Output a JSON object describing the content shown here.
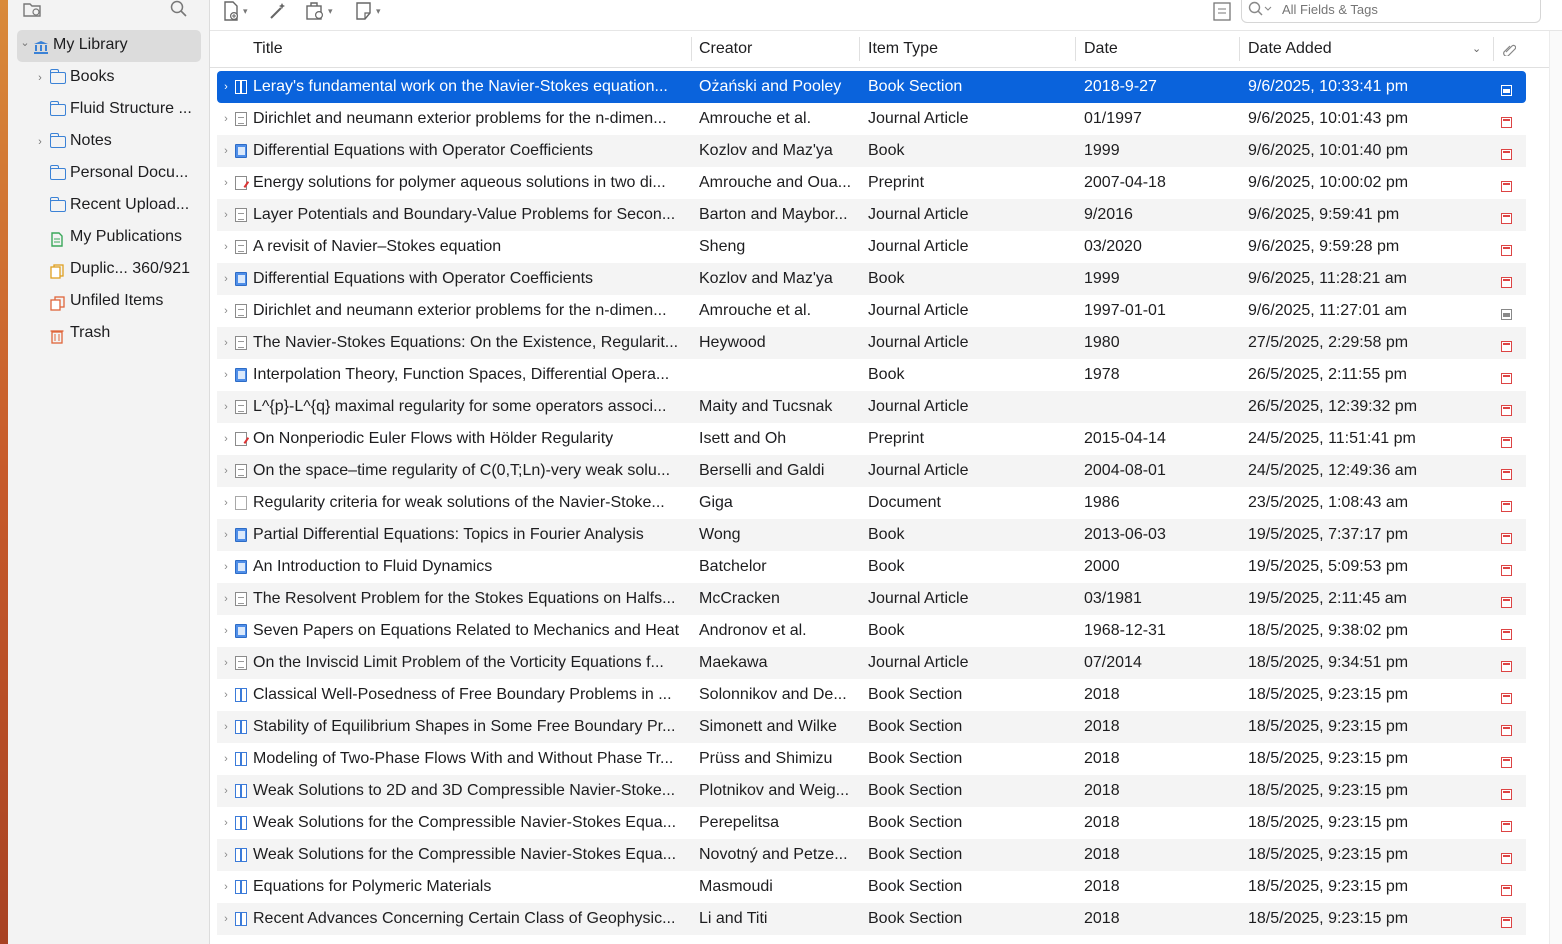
{
  "sidebar": {
    "items": [
      {
        "label": "My Library",
        "icon": "library-icon",
        "selected": true,
        "expandable": true,
        "expanded": true
      },
      {
        "label": "Books",
        "icon": "folder-icon",
        "expandable": true
      },
      {
        "label": "Fluid Structure ...",
        "icon": "folder-icon"
      },
      {
        "label": "Notes",
        "icon": "folder-icon",
        "expandable": true
      },
      {
        "label": "Personal Docu...",
        "icon": "folder-icon"
      },
      {
        "label": "Recent Upload...",
        "icon": "folder-icon"
      },
      {
        "label": "My Publications",
        "icon": "publications-icon"
      },
      {
        "label": "Duplic... 360/921",
        "icon": "duplicates-icon"
      },
      {
        "label": "Unfiled Items",
        "icon": "unfiled-icon"
      },
      {
        "label": "Trash",
        "icon": "trash-icon"
      }
    ]
  },
  "search": {
    "placeholder": "All Fields & Tags"
  },
  "columns": {
    "title": "Title",
    "creator": "Creator",
    "item_type": "Item Type",
    "date": "Date",
    "date_added": "Date Added"
  },
  "items": [
    {
      "title": "Leray's fundamental work on the Navier-Stokes equation...",
      "creator": "Ożański and Pooley",
      "type": "Book Section",
      "date": "2018-9-27",
      "added": "9/6/2025, 10:33:41 pm",
      "icon": "section",
      "att": "snap",
      "selected": true
    },
    {
      "title": "Dirichlet and neumann exterior problems for the n-dimen...",
      "creator": "Amrouche et al.",
      "type": "Journal Article",
      "date": "01/1997",
      "added": "9/6/2025, 10:01:43 pm",
      "icon": "article",
      "att": "pdf"
    },
    {
      "title": "Differential Equations with Operator Coefficients",
      "creator": "Kozlov and Maz'ya",
      "type": "Book",
      "date": "1999",
      "added": "9/6/2025, 10:01:40 pm",
      "icon": "book",
      "att": "pdf"
    },
    {
      "title": "Energy solutions for polymer aqueous solutions in two di...",
      "creator": "Amrouche and Oua...",
      "type": "Preprint",
      "date": "2007-04-18",
      "added": "9/6/2025, 10:00:02 pm",
      "icon": "preprint",
      "att": "pdf"
    },
    {
      "title": "Layer Potentials and Boundary-Value Problems for Secon...",
      "creator": "Barton and Maybor...",
      "type": "Journal Article",
      "date": "9/2016",
      "added": "9/6/2025, 9:59:41 pm",
      "icon": "article",
      "att": "pdf"
    },
    {
      "title": "A revisit of Navier–Stokes equation",
      "creator": "Sheng",
      "type": "Journal Article",
      "date": "03/2020",
      "added": "9/6/2025, 9:59:28 pm",
      "icon": "article",
      "att": "pdf"
    },
    {
      "title": "Differential Equations with Operator Coefficients",
      "creator": "Kozlov and Maz'ya",
      "type": "Book",
      "date": "1999",
      "added": "9/6/2025, 11:28:21 am",
      "icon": "book",
      "att": "pdf"
    },
    {
      "title": "Dirichlet and neumann exterior problems for the n-dimen...",
      "creator": "Amrouche et al.",
      "type": "Journal Article",
      "date": "1997-01-01",
      "added": "9/6/2025, 11:27:01 am",
      "icon": "article",
      "att": "snap"
    },
    {
      "title": "The Navier-Stokes Equations: On the Existence, Regularit...",
      "creator": "Heywood",
      "type": "Journal Article",
      "date": "1980",
      "added": "27/5/2025, 2:29:58 pm",
      "icon": "article",
      "att": "pdf"
    },
    {
      "title": "Interpolation Theory, Function Spaces, Differential Opera...",
      "creator": "",
      "type": "Book",
      "date": "1978",
      "added": "26/5/2025, 2:11:55 pm",
      "icon": "book",
      "att": "pdf"
    },
    {
      "title": "L^{p}-L^{q} maximal regularity for some operators associ...",
      "creator": "Maity and Tucsnak",
      "type": "Journal Article",
      "date": "",
      "added": "26/5/2025, 12:39:32 pm",
      "icon": "article",
      "att": "pdf"
    },
    {
      "title": "On Nonperiodic Euler Flows with Hölder Regularity",
      "creator": "Isett and Oh",
      "type": "Preprint",
      "date": "2015-04-14",
      "added": "24/5/2025, 11:51:41 pm",
      "icon": "preprint",
      "att": "pdf"
    },
    {
      "title": "On the space–time regularity of C(0,T;Ln)-very weak solu...",
      "creator": "Berselli and Galdi",
      "type": "Journal Article",
      "date": "2004-08-01",
      "added": "24/5/2025, 12:49:36 am",
      "icon": "article",
      "att": "pdf"
    },
    {
      "title": "Regularity criteria for weak solutions of the Navier-Stoke...",
      "creator": "Giga",
      "type": "Document",
      "date": "1986",
      "added": "23/5/2025, 1:08:43 am",
      "icon": "document",
      "att": "pdf"
    },
    {
      "title": "Partial Differential Equations: Topics in Fourier Analysis",
      "creator": "Wong",
      "type": "Book",
      "date": "2013-06-03",
      "added": "19/5/2025, 7:37:17 pm",
      "icon": "book",
      "att": "pdf"
    },
    {
      "title": "An Introduction to Fluid Dynamics",
      "creator": "Batchelor",
      "type": "Book",
      "date": "2000",
      "added": "19/5/2025, 5:09:53 pm",
      "icon": "book",
      "att": "pdf"
    },
    {
      "title": "The Resolvent Problem for the Stokes Equations on Halfs...",
      "creator": "McCracken",
      "type": "Journal Article",
      "date": "03/1981",
      "added": "19/5/2025, 2:11:45 am",
      "icon": "article",
      "att": "pdf"
    },
    {
      "title": "Seven Papers on Equations Related to Mechanics and Heat",
      "creator": "Andronov et al.",
      "type": "Book",
      "date": "1968-12-31",
      "added": "18/5/2025, 9:38:02 pm",
      "icon": "book",
      "att": "pdf"
    },
    {
      "title": "On the Inviscid Limit Problem of the Vorticity Equations f...",
      "creator": "Maekawa",
      "type": "Journal Article",
      "date": "07/2014",
      "added": "18/5/2025, 9:34:51 pm",
      "icon": "article",
      "att": "pdf"
    },
    {
      "title": "Classical Well-Posedness of Free Boundary Problems in ...",
      "creator": "Solonnikov and De...",
      "type": "Book Section",
      "date": "2018",
      "added": "18/5/2025, 9:23:15 pm",
      "icon": "section",
      "att": "pdf"
    },
    {
      "title": "Stability of Equilibrium Shapes in Some Free Boundary Pr...",
      "creator": "Simonett and Wilke",
      "type": "Book Section",
      "date": "2018",
      "added": "18/5/2025, 9:23:15 pm",
      "icon": "section",
      "att": "pdf"
    },
    {
      "title": "Modeling of Two-Phase Flows With and Without Phase Tr...",
      "creator": "Prüss and Shimizu",
      "type": "Book Section",
      "date": "2018",
      "added": "18/5/2025, 9:23:15 pm",
      "icon": "section",
      "att": "pdf"
    },
    {
      "title": "Weak Solutions to 2D and 3D Compressible Navier-Stoke...",
      "creator": "Plotnikov and Weig...",
      "type": "Book Section",
      "date": "2018",
      "added": "18/5/2025, 9:23:15 pm",
      "icon": "section",
      "att": "pdf"
    },
    {
      "title": "Weak Solutions for the Compressible Navier-Stokes Equa...",
      "creator": "Perepelitsa",
      "type": "Book Section",
      "date": "2018",
      "added": "18/5/2025, 9:23:15 pm",
      "icon": "section",
      "att": "pdf"
    },
    {
      "title": "Weak Solutions for the Compressible Navier-Stokes Equa...",
      "creator": "Novotný and Petze...",
      "type": "Book Section",
      "date": "2018",
      "added": "18/5/2025, 9:23:15 pm",
      "icon": "section",
      "att": "pdf"
    },
    {
      "title": "Equations for Polymeric Materials",
      "creator": "Masmoudi",
      "type": "Book Section",
      "date": "2018",
      "added": "18/5/2025, 9:23:15 pm",
      "icon": "section",
      "att": "pdf"
    },
    {
      "title": "Recent Advances Concerning Certain Class of Geophysic...",
      "creator": "Li and Titi",
      "type": "Book Section",
      "date": "2018",
      "added": "18/5/2025, 9:23:15 pm",
      "icon": "section",
      "att": "pdf"
    }
  ],
  "colors": {
    "selection": "#0a63dc",
    "folder": "#3b82d6",
    "pdf": "#d44444"
  }
}
